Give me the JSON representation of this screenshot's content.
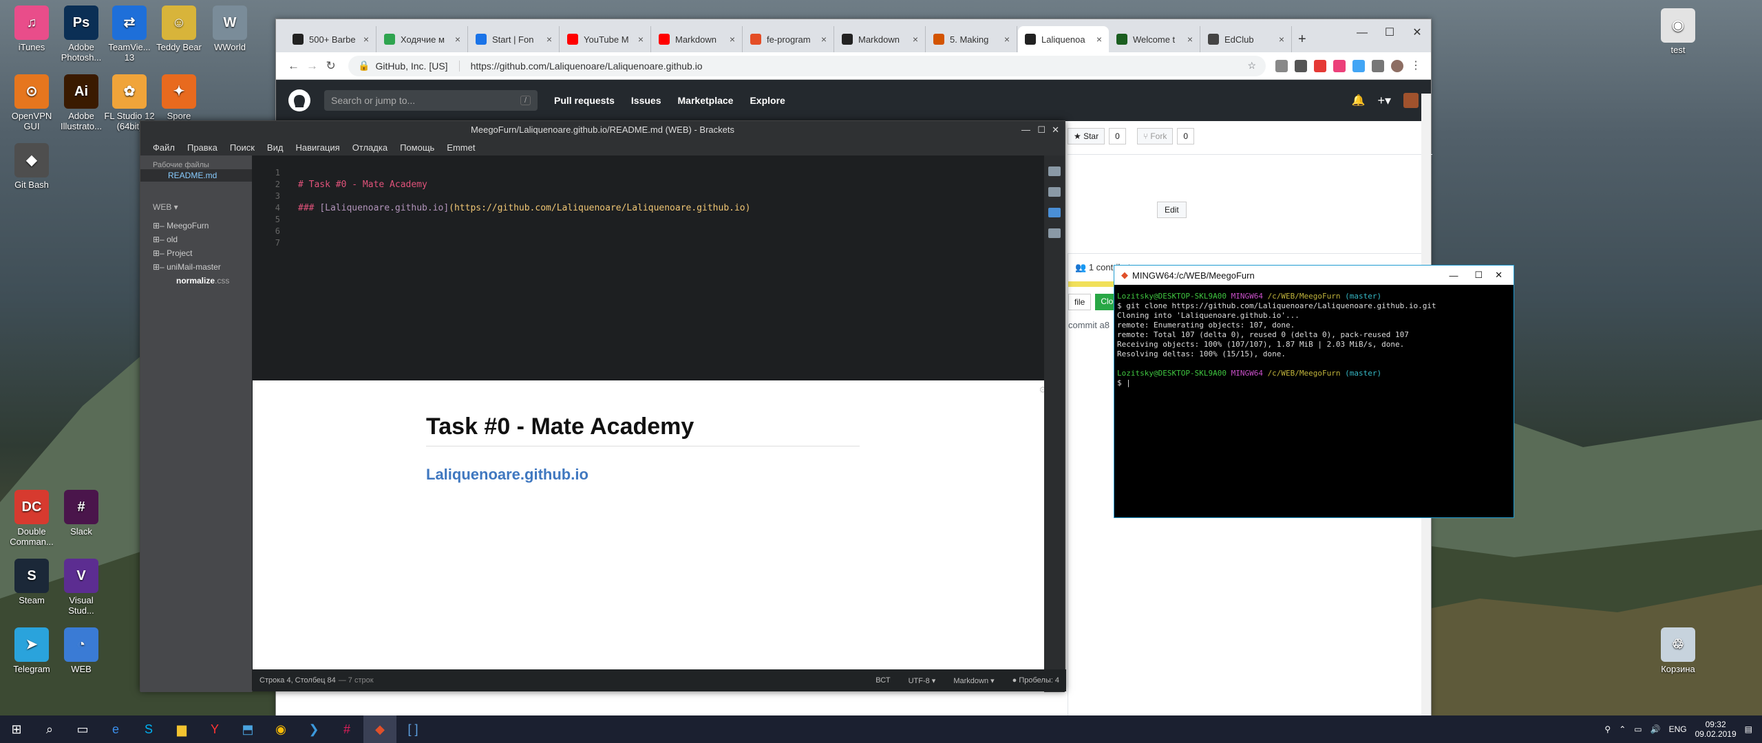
{
  "desktop": {
    "icons": [
      {
        "label": "iTunes",
        "color": "#e94d8a",
        "glyph": "♫"
      },
      {
        "label": "Adobe Photosh...",
        "color": "#0b2f55",
        "glyph": "Ps"
      },
      {
        "label": "TeamVie... 13",
        "color": "#1e6fd9",
        "glyph": "⇄"
      },
      {
        "label": "Teddy Bear",
        "color": "#d8b43a",
        "glyph": "☺"
      },
      {
        "label": "WWorld",
        "color": "#7a8c99",
        "glyph": "W"
      },
      {
        "label": "OpenVPN GUI",
        "color": "#e6761e",
        "glyph": "⊙"
      },
      {
        "label": "Adobe Illustrato...",
        "color": "#3a1a00",
        "glyph": "Ai"
      },
      {
        "label": "FL Studio 12 (64bit)",
        "color": "#f0a43a",
        "glyph": "✿"
      },
      {
        "label": "Spore",
        "color": "#e86a1e",
        "glyph": "✦"
      },
      {
        "label": "Git Bash",
        "color": "#4e4e4e",
        "glyph": "◆"
      },
      {
        "label": "Double Comman...",
        "color": "#d73a2f",
        "glyph": "DC"
      },
      {
        "label": "Slack",
        "color": "#4a154b",
        "glyph": "#"
      },
      {
        "label": "Steam",
        "color": "#1b2838",
        "glyph": "S"
      },
      {
        "label": "Visual Stud...",
        "color": "#5c2d91",
        "glyph": "V"
      },
      {
        "label": "Telegram",
        "color": "#2aa3dc",
        "glyph": "➤"
      },
      {
        "label": "WEB",
        "color": "#3a7bd5",
        "glyph": "◔"
      },
      {
        "label": "test",
        "color": "#e3e3e3",
        "glyph": "◉"
      },
      {
        "label": "Корзина",
        "color": "#c7d3dd",
        "glyph": "♲"
      }
    ]
  },
  "chrome": {
    "tabs": [
      {
        "label": "500+ Barbe",
        "color": "#222"
      },
      {
        "label": "Ходячие м",
        "color": "#2ea44f"
      },
      {
        "label": "Start | Fon",
        "color": "#1a73e8"
      },
      {
        "label": "YouTube M",
        "color": "#ff0000"
      },
      {
        "label": "Markdown",
        "color": "#ff0000"
      },
      {
        "label": "fe-program",
        "color": "#e44d26"
      },
      {
        "label": "Markdown",
        "color": "#222"
      },
      {
        "label": "5. Making",
        "color": "#d35400"
      },
      {
        "label": "Laliquenoa",
        "color": "#222"
      },
      {
        "label": "Welcome t",
        "color": "#1b5e20"
      },
      {
        "label": "EdClub",
        "color": "#444"
      }
    ],
    "org": "GitHub, Inc. [US]",
    "url": "https://github.com/Laliquenoare/Laliquenoare.github.io",
    "github": {
      "search_placeholder": "Search or jump to...",
      "slash": "/",
      "nav": [
        "Pull requests",
        "Issues",
        "Marketplace",
        "Explore"
      ],
      "star_label": "Star",
      "star_count": "0",
      "fork_label": "Fork",
      "fork_count": "0",
      "edit_label": "Edit",
      "contributors": "1 contributor",
      "file_label": "file",
      "clone_label": "Clon",
      "commit_label": "commit a8"
    }
  },
  "brackets": {
    "title": "MeegoFurn/Laliquenoare.github.io/README.md (WEB) - Brackets",
    "menu": [
      "Файл",
      "Правка",
      "Поиск",
      "Вид",
      "Навигация",
      "Отладка",
      "Помощь",
      "Emmet"
    ],
    "working_files_label": "Рабочие файлы",
    "working_file": "README.md",
    "project": "WEB",
    "tree": [
      "MeegoFurn",
      "old",
      "Project",
      "uniMail-master"
    ],
    "tree_file": "normalize",
    "tree_file_ext": ".css",
    "lines": [
      "1",
      "2",
      "3",
      "4",
      "5",
      "6",
      "7"
    ],
    "code_line2": "# Task #0 - Mate Academy",
    "code_line4_prefix": "### ",
    "code_line4_link": "[Laliquenoare.github.io]",
    "code_line4_url": "(https://github.com/Laliquenoare/Laliquenoare.github.io)",
    "preview_h1": "Task #0 - Mate Academy",
    "preview_h3": "Laliquenoare.github.io",
    "status": {
      "cursor": "Строка 4, Столбец 84",
      "lines": "— 7 строк",
      "mode": "ВСТ",
      "encoding": "UTF-8",
      "language": "Markdown",
      "spaces": "Пробелы: 4"
    }
  },
  "bash": {
    "title": "MINGW64:/c/WEB/MeegoFurn",
    "user": "Lozitsky@DESKTOP-SKL9A00",
    "env": "MINGW64",
    "path": "/c/WEB/MeegoFurn",
    "branch": "(master)",
    "command": "$ git clone https://github.com/Laliquenoare/Laliquenoare.github.io.git",
    "output": [
      "Cloning into 'Laliquenoare.github.io'...",
      "remote: Enumerating objects: 107, done.",
      "remote: Total 107 (delta 0), reused 0 (delta 0), pack-reused 107",
      "Receiving objects: 100% (107/107), 1.87 MiB | 2.03 MiB/s, done.",
      "Resolving deltas: 100% (15/15), done."
    ],
    "prompt": "$ |"
  },
  "taskbar": {
    "lang": "ENG",
    "time": "09:32",
    "date": "09.02.2019"
  }
}
